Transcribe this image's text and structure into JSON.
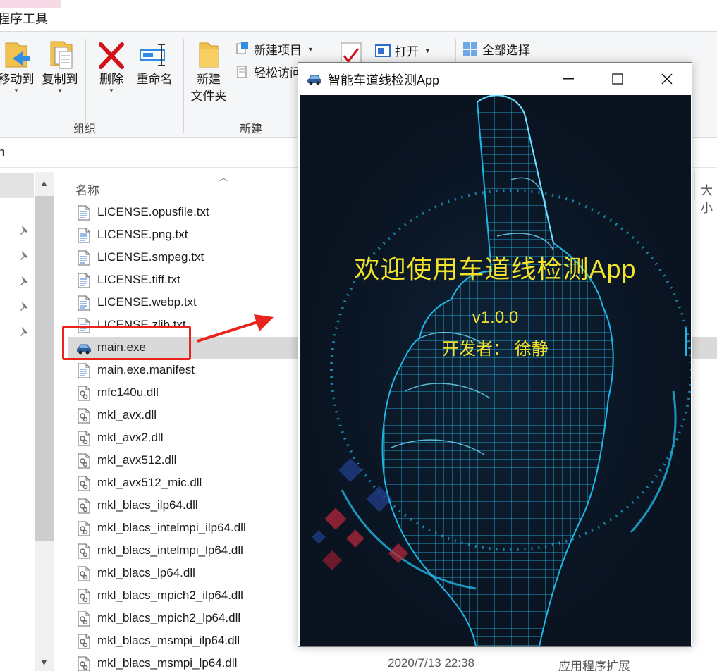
{
  "ribbon": {
    "tab_label": "程序工具",
    "move_to": "移动到",
    "copy_to": "复制到",
    "delete": "删除",
    "rename": "重命名",
    "new_folder_line1": "新建",
    "new_folder_line2": "文件夹",
    "new_item": "新建项目",
    "easy_access": "轻松访问",
    "open": "打开",
    "select_all": "全部选择",
    "group_organize": "组织",
    "group_new": "新建"
  },
  "address": {
    "text": "n"
  },
  "columns": {
    "name": "名称",
    "size": "大小"
  },
  "files": [
    {
      "name": "LICENSE.opusfile.txt",
      "icon": "text-file-icon"
    },
    {
      "name": "LICENSE.png.txt",
      "icon": "text-file-icon"
    },
    {
      "name": "LICENSE.smpeg.txt",
      "icon": "text-file-icon"
    },
    {
      "name": "LICENSE.tiff.txt",
      "icon": "text-file-icon"
    },
    {
      "name": "LICENSE.webp.txt",
      "icon": "text-file-icon"
    },
    {
      "name": "LICENSE.zlib.txt",
      "icon": "text-file-icon"
    },
    {
      "name": "main.exe",
      "icon": "exe-icon",
      "selected": true
    },
    {
      "name": "main.exe.manifest",
      "icon": "text-file-icon"
    },
    {
      "name": "mfc140u.dll",
      "icon": "dll-icon"
    },
    {
      "name": "mkl_avx.dll",
      "icon": "dll-icon"
    },
    {
      "name": "mkl_avx2.dll",
      "icon": "dll-icon"
    },
    {
      "name": "mkl_avx512.dll",
      "icon": "dll-icon"
    },
    {
      "name": "mkl_avx512_mic.dll",
      "icon": "dll-icon"
    },
    {
      "name": "mkl_blacs_ilp64.dll",
      "icon": "dll-icon"
    },
    {
      "name": "mkl_blacs_intelmpi_ilp64.dll",
      "icon": "dll-icon"
    },
    {
      "name": "mkl_blacs_intelmpi_lp64.dll",
      "icon": "dll-icon"
    },
    {
      "name": "mkl_blacs_lp64.dll",
      "icon": "dll-icon"
    },
    {
      "name": "mkl_blacs_mpich2_ilp64.dll",
      "icon": "dll-icon"
    },
    {
      "name": "mkl_blacs_mpich2_lp64.dll",
      "icon": "dll-icon"
    },
    {
      "name": "mkl_blacs_msmpi_ilp64.dll",
      "icon": "dll-icon"
    },
    {
      "name": "mkl_blacs_msmpi_lp64.dll",
      "icon": "dll-icon",
      "date": "2020/7/13 22:38",
      "type": "应用程序扩展"
    }
  ],
  "app_window": {
    "title": "智能车道线检测App",
    "splash_title": "欢迎使用车道线检测App",
    "version": "v1.0.0",
    "developer": "开发者： 徐静"
  },
  "colors": {
    "annotation_red": "#e8241c",
    "splash_text": "#f3e22a",
    "wireframe": "#1fb6e6"
  }
}
